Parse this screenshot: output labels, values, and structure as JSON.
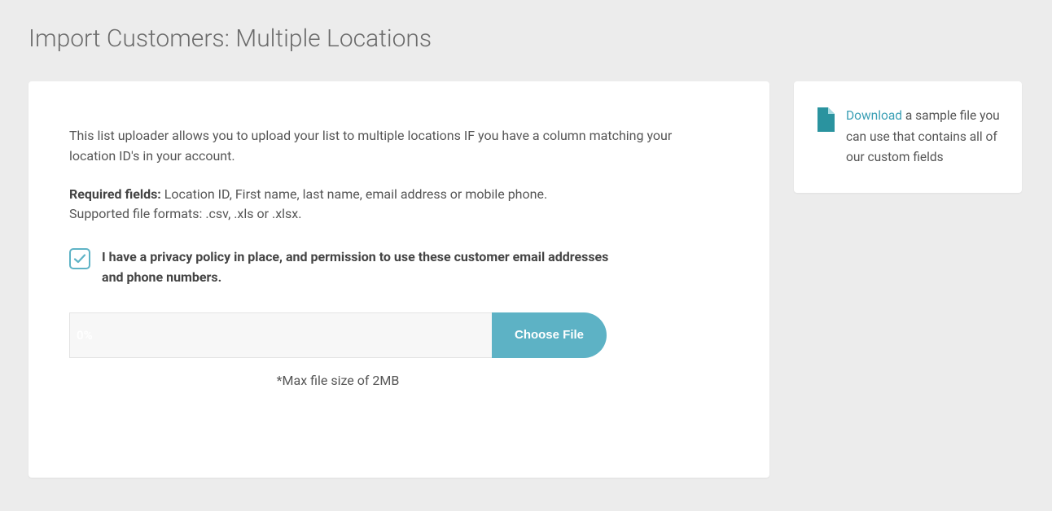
{
  "page": {
    "title": "Import Customers: Multiple Locations"
  },
  "main": {
    "description": "This list uploader allows you to upload your list to multiple locations IF you have a column matching your location ID's in your account.",
    "required_label": "Required fields:",
    "required_text": " Location ID, First name, last name, email address or mobile phone.",
    "supported_text": "Supported file formats: .csv, .xls or .xlsx.",
    "consent_checked": true,
    "consent_label": "I have a privacy policy in place, and permission to use these customer email addresses and phone numbers.",
    "progress_text": "0%",
    "choose_file_label": "Choose File",
    "max_size_note": "*Max file size of 2MB"
  },
  "sidebar": {
    "download_link_text": "Download",
    "download_rest": " a sample file you can use that contains all of our custom fields"
  },
  "colors": {
    "accent": "#5db2c5",
    "link": "#3b9fb5"
  }
}
